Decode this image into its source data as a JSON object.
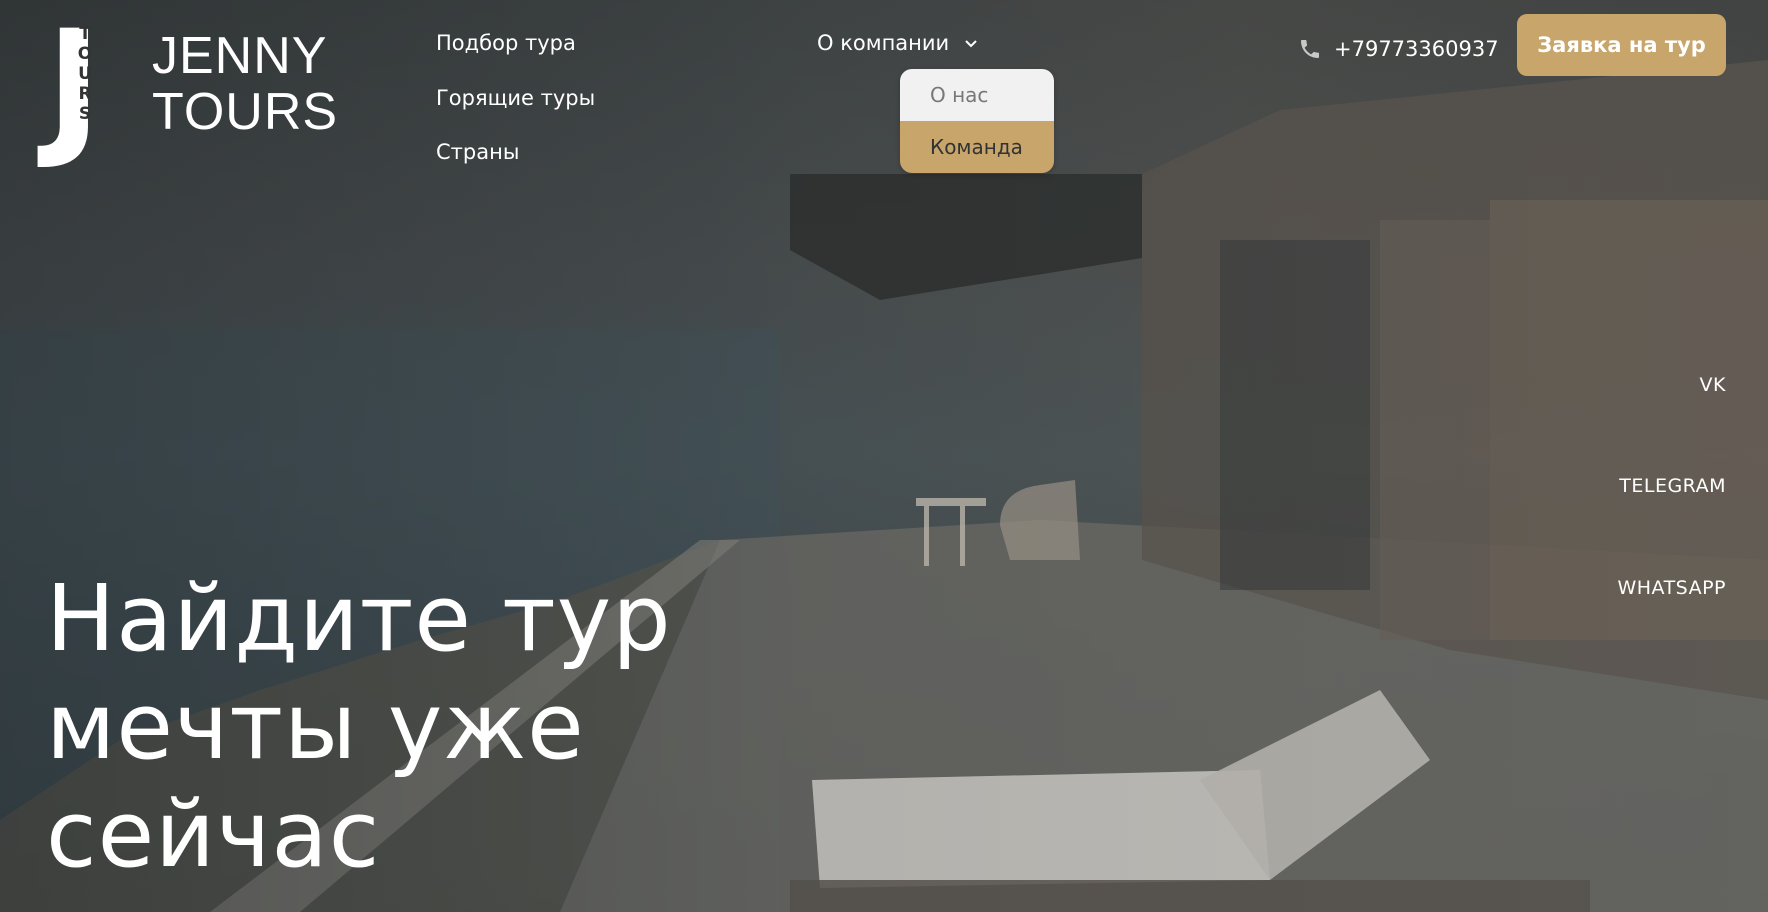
{
  "logo": {
    "mark_letter": "J",
    "mark_vertical_text": "TOURS",
    "line1": "JENNY",
    "line2": "TOURS"
  },
  "nav": {
    "items": [
      {
        "label": "Подбор тура"
      },
      {
        "label": "Горящие туры"
      },
      {
        "label": "Страны"
      }
    ],
    "company": {
      "label": "О компании",
      "icon": "chevron-down-icon",
      "dropdown": [
        {
          "label": "О нас"
        },
        {
          "label": "Команда"
        }
      ]
    }
  },
  "contact": {
    "phone": "+79773360937",
    "phone_icon": "phone-icon"
  },
  "cta": {
    "label": "Заявка на тур"
  },
  "social": {
    "items": [
      {
        "label": "VK"
      },
      {
        "label": "TELEGRAM"
      },
      {
        "label": "WHATSAPP"
      }
    ]
  },
  "hero": {
    "headline_lines": [
      "Найдите тур",
      "мечты уже",
      "сейчас"
    ]
  },
  "colors": {
    "accent": "#c8a56b",
    "dropdown_bg": "#f1f1f1",
    "text": "#ffffff"
  }
}
